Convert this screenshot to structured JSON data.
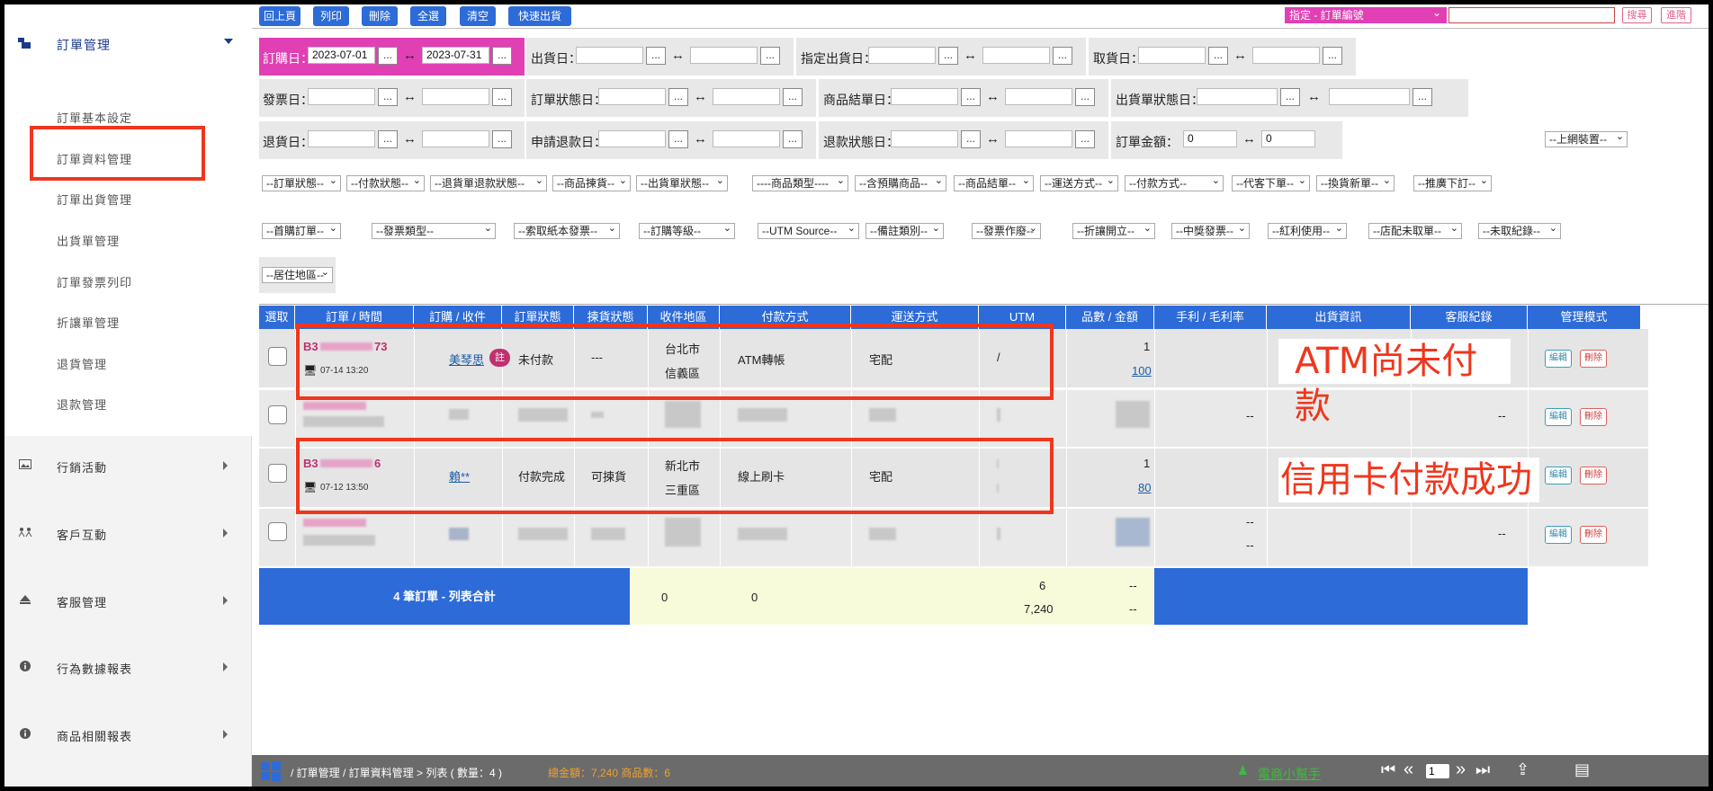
{
  "sidebar": {
    "top": {
      "label": "訂單管理"
    },
    "sub_items": [
      "訂單基本設定",
      "訂單資料管理",
      "訂單出貨管理",
      "出貨單管理",
      "訂單發票列印",
      "折讓單管理",
      "退貨管理",
      "退款管理"
    ],
    "items": [
      {
        "label": "行銷活動",
        "icon": "image-icon"
      },
      {
        "label": "客戶互動",
        "icon": "people-icon"
      },
      {
        "label": "客服管理",
        "icon": "eject-icon"
      },
      {
        "label": "行為數據報表",
        "icon": "info-icon"
      },
      {
        "label": "商品相關報表",
        "icon": "info-icon"
      }
    ]
  },
  "toolbar": {
    "buttons": [
      "回上頁",
      "列印",
      "刪除",
      "全選",
      "清空",
      "快速出貨"
    ],
    "search_select": "指定 - 訂單編號",
    "search_btn": "搜尋",
    "advanced_btn": "進階"
  },
  "filters": {
    "order_date": {
      "label": "訂購日：",
      "from": "2023-07-01",
      "to": "2023-07-31"
    },
    "ship_date": {
      "label": "出貨日："
    },
    "assigned_ship_date": {
      "label": "指定出貨日："
    },
    "pickup_date": {
      "label": "取貨日："
    },
    "invoice_date": {
      "label": "發票日："
    },
    "order_status_date": {
      "label": "訂單狀態日："
    },
    "settle_date": {
      "label": "商品結單日："
    },
    "ship_status_date": {
      "label": "出貨單狀態日："
    },
    "return_date": {
      "label": "退貨日："
    },
    "refund_apply_date": {
      "label": "申請退款日："
    },
    "refund_status_date": {
      "label": "退款狀態日："
    },
    "order_amount": {
      "label": "訂單金額：",
      "from": "0",
      "to": "0"
    },
    "device": "--上網裝置--",
    "dots": "...",
    "arrow": "↔"
  },
  "dropdowns_row1": [
    "--訂單狀態--",
    "--付款狀態--",
    "--退貨單退款狀態--",
    "--商品揀貨--",
    "--出貨單狀態--",
    "----商品類型----",
    "--含預購商品--",
    "--商品結單--",
    "--運送方式--",
    "--付款方式--",
    "--代客下單--",
    "--換貨新單--",
    "--推廣下訂--"
  ],
  "dropdowns_row2": [
    "--首購訂單--",
    "--發票類型--",
    "--索取紙本發票--",
    "--訂購等級--",
    "--UTM Source--",
    "--備註類別--",
    "--發票作廢--",
    "--折讓開立--",
    "--中獎發票--",
    "--紅利使用--",
    "--店配未取單--",
    "--未取紀錄--"
  ],
  "dropdown_row3": "--居住地區--",
  "table": {
    "headers": [
      "選取",
      "訂單 / 時間",
      "訂購 / 收件",
      "訂單狀態",
      "揀貨狀態",
      "收件地區",
      "付款方式",
      "運送方式",
      "UTM",
      "品數 / 金額",
      "手利 / 毛利率",
      "出貨資訊",
      "客服紀錄",
      "管理模式"
    ],
    "rows": [
      {
        "order_prefix": "B3",
        "order_suffix": "73",
        "time": "07-14 13:20",
        "buyer": "美琴思",
        "note_badge": "註",
        "status": "未付款",
        "pick": "---",
        "city": "台北市",
        "district": "信義區",
        "payment": "ATM轉帳",
        "shipping": "宅配",
        "utm": "/",
        "qty": "1",
        "amount": "100",
        "cs": "--"
      },
      {
        "cs": "--",
        "profit": "--"
      },
      {
        "order_prefix": "B3",
        "order_suffix": "6",
        "time": "07-12 13:50",
        "buyer": "賴**",
        "status": "付款完成",
        "pick": "可揀貨",
        "city": "新北市",
        "district": "三重區",
        "payment": "線上刷卡",
        "shipping": "宅配",
        "qty": "1",
        "amount": "80",
        "cs": "--"
      },
      {
        "cs": "--",
        "profit1": "--",
        "profit2": "--"
      }
    ],
    "edit_label": "編輯",
    "delete_label": "刪除",
    "summary": {
      "label": "4 筆訂單 - 列表合計",
      "pick": "0",
      "payment": "0",
      "qty": "6",
      "amount": "7,240",
      "profit1": "--",
      "profit2": "--"
    }
  },
  "annotations": {
    "atm": "ATM尚未付款",
    "card": "信用卡付款成功"
  },
  "footer": {
    "breadcrumb": "/ 訂單管理 / 訂單資料管理 > 列表 ( 數量：4 )",
    "totals": "總金額：7,240 商品數：6",
    "helper": "電商小幫手",
    "page": "1"
  },
  "colors": {
    "accent": "#2d6bd8",
    "pink": "#e040b4",
    "annotation": "#f0361d"
  }
}
